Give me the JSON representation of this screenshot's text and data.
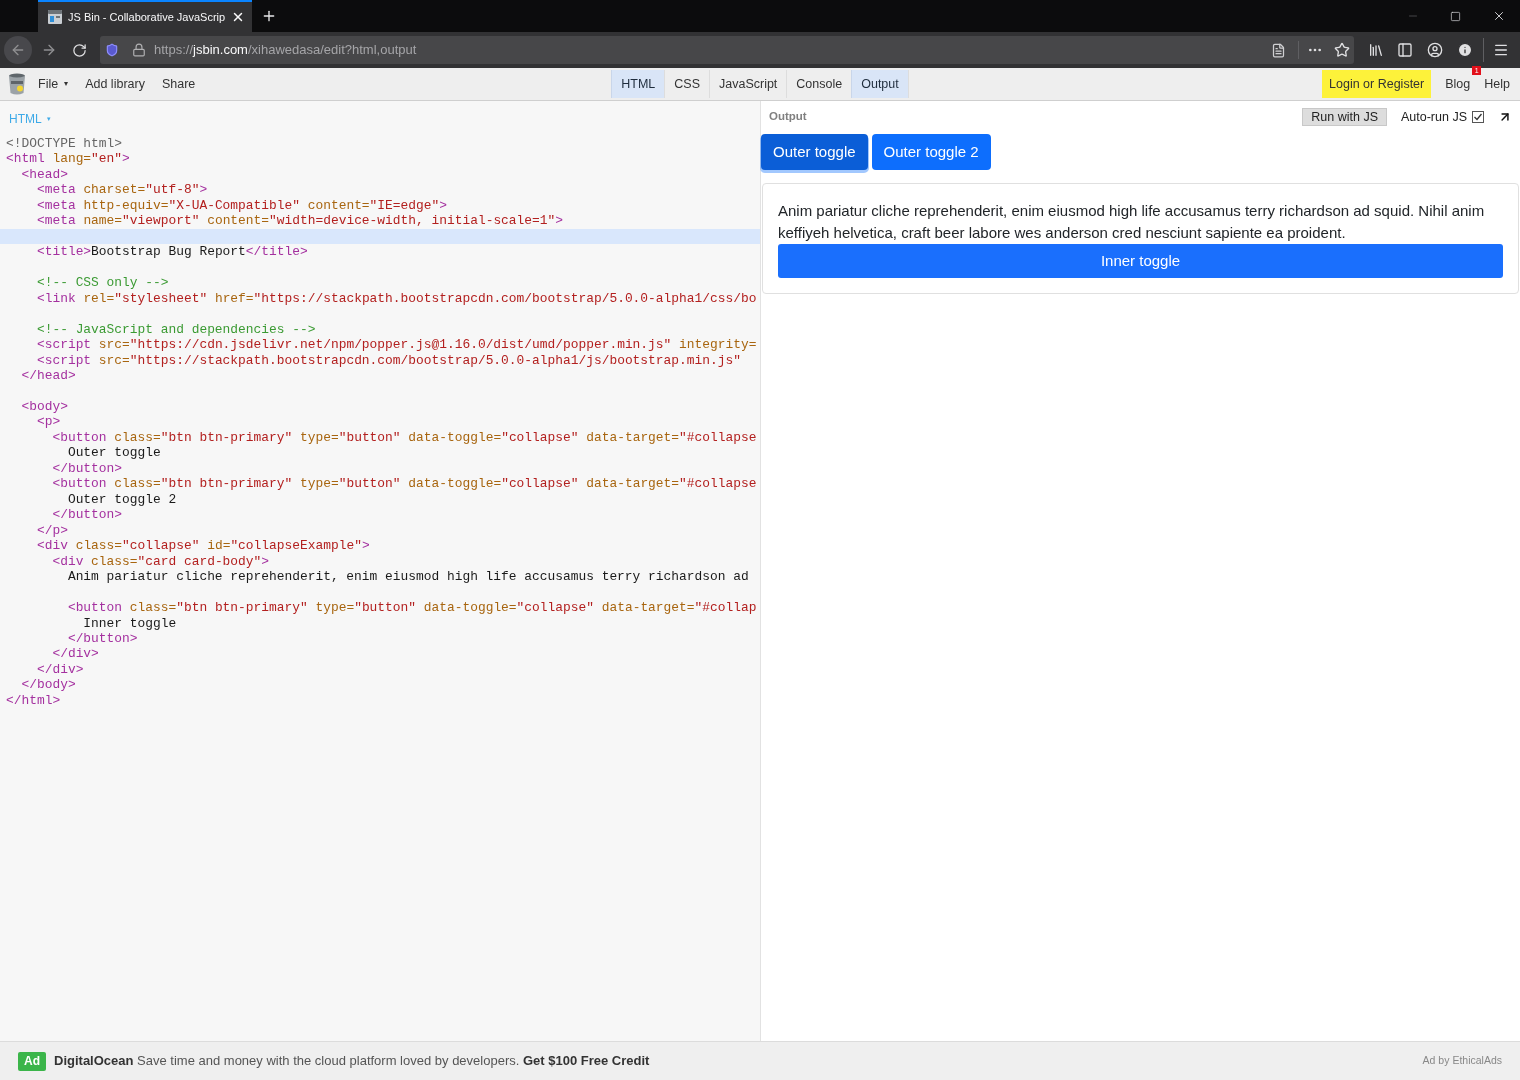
{
  "browser": {
    "tab": {
      "title": "JS Bin - Collaborative JavaScrip",
      "selected": true
    },
    "url": {
      "scheme": "https://",
      "host": "jsbin.com",
      "path": "/xihawedasa/edit?html,output"
    }
  },
  "toolbar": {
    "menu": [
      {
        "label": "File",
        "caret": "▾"
      },
      {
        "label": "Add library"
      },
      {
        "label": "Share"
      }
    ],
    "panels": [
      {
        "label": "HTML",
        "selected": true
      },
      {
        "label": "CSS",
        "selected": false
      },
      {
        "label": "JavaScript",
        "selected": false
      },
      {
        "label": "Console",
        "selected": false
      },
      {
        "label": "Output",
        "selected": true
      }
    ],
    "login": "Login or Register",
    "links": [
      {
        "label": "Blog",
        "badge": "1"
      },
      {
        "label": "Help"
      }
    ]
  },
  "editor": {
    "language": "HTML",
    "caret": "▾",
    "lines": [
      {
        "active": false,
        "tokens": [
          {
            "kind": "meta",
            "text": "<!DOCTYPE html>"
          }
        ]
      },
      {
        "active": false,
        "tokens": [
          {
            "kind": "tag",
            "text": "<html"
          },
          {
            "kind": "attr",
            "text": " lang="
          },
          {
            "kind": "string",
            "text": "\"en\""
          },
          {
            "kind": "tag",
            "text": ">"
          }
        ]
      },
      {
        "active": false,
        "tokens": [
          {
            "kind": "tag",
            "text": "  <head>"
          }
        ]
      },
      {
        "active": false,
        "tokens": [
          {
            "kind": "tag",
            "text": "    <meta"
          },
          {
            "kind": "attr",
            "text": " charset="
          },
          {
            "kind": "string",
            "text": "\"utf-8\""
          },
          {
            "kind": "tag",
            "text": ">"
          }
        ]
      },
      {
        "active": false,
        "tokens": [
          {
            "kind": "tag",
            "text": "    <meta"
          },
          {
            "kind": "attr",
            "text": " http-equiv="
          },
          {
            "kind": "string",
            "text": "\"X-UA-Compatible\""
          },
          {
            "kind": "attr",
            "text": " content="
          },
          {
            "kind": "string",
            "text": "\"IE=edge\""
          },
          {
            "kind": "tag",
            "text": ">"
          }
        ]
      },
      {
        "active": false,
        "tokens": [
          {
            "kind": "tag",
            "text": "    <meta"
          },
          {
            "kind": "attr",
            "text": " name="
          },
          {
            "kind": "string",
            "text": "\"viewport\""
          },
          {
            "kind": "attr",
            "text": " content="
          },
          {
            "kind": "string",
            "text": "\"width=device-width, initial-scale=1\""
          },
          {
            "kind": "tag",
            "text": ">"
          }
        ]
      },
      {
        "active": true
      },
      {
        "active": false,
        "tokens": [
          {
            "kind": "tag",
            "text": "    <title>"
          },
          {
            "kind": "text",
            "text": "Bootstrap Bug Report"
          },
          {
            "kind": "tag",
            "text": "</title>"
          }
        ]
      },
      {
        "active": false
      },
      {
        "active": false,
        "tokens": [
          {
            "kind": "comment",
            "text": "    <!-- CSS only -->"
          }
        ]
      },
      {
        "active": false,
        "tokens": [
          {
            "kind": "tag",
            "text": "    <link"
          },
          {
            "kind": "attr",
            "text": " rel="
          },
          {
            "kind": "string",
            "text": "\"stylesheet\""
          },
          {
            "kind": "attr",
            "text": " href="
          },
          {
            "kind": "string",
            "text": "\"https://stackpath.bootstrapcdn.com/bootstrap/5.0.0-alpha1/css/bo"
          }
        ]
      },
      {
        "active": false
      },
      {
        "active": false,
        "tokens": [
          {
            "kind": "comment",
            "text": "    <!-- JavaScript and dependencies -->"
          }
        ]
      },
      {
        "active": false,
        "tokens": [
          {
            "kind": "tag",
            "text": "    <script"
          },
          {
            "kind": "attr",
            "text": " src="
          },
          {
            "kind": "string",
            "text": "\"https://cdn.jsdelivr.net/npm/popper.js@1.16.0/dist/umd/popper.min.js\""
          },
          {
            "kind": "attr",
            "text": " integrity="
          }
        ]
      },
      {
        "active": false,
        "tokens": [
          {
            "kind": "tag",
            "text": "    <script"
          },
          {
            "kind": "attr",
            "text": " src="
          },
          {
            "kind": "string",
            "text": "\"https://stackpath.bootstrapcdn.com/bootstrap/5.0.0-alpha1/js/bootstrap.min.js\""
          }
        ]
      },
      {
        "active": false,
        "tokens": [
          {
            "kind": "tag",
            "text": "  </head>"
          }
        ]
      },
      {
        "active": false
      },
      {
        "active": false,
        "tokens": [
          {
            "kind": "tag",
            "text": "  <body>"
          }
        ]
      },
      {
        "active": false,
        "tokens": [
          {
            "kind": "tag",
            "text": "    <p>"
          }
        ]
      },
      {
        "active": false,
        "tokens": [
          {
            "kind": "tag",
            "text": "      <button"
          },
          {
            "kind": "attr",
            "text": " class="
          },
          {
            "kind": "string",
            "text": "\"btn btn-primary\""
          },
          {
            "kind": "attr",
            "text": " type="
          },
          {
            "kind": "string",
            "text": "\"button\""
          },
          {
            "kind": "attr",
            "text": " data-toggle="
          },
          {
            "kind": "string",
            "text": "\"collapse\""
          },
          {
            "kind": "attr",
            "text": " data-target="
          },
          {
            "kind": "string",
            "text": "\"#collapse"
          }
        ]
      },
      {
        "active": false,
        "tokens": [
          {
            "kind": "text",
            "text": "        Outer toggle"
          }
        ]
      },
      {
        "active": false,
        "tokens": [
          {
            "kind": "tag",
            "text": "      </button>"
          }
        ]
      },
      {
        "active": false,
        "tokens": [
          {
            "kind": "tag",
            "text": "      <button"
          },
          {
            "kind": "attr",
            "text": " class="
          },
          {
            "kind": "string",
            "text": "\"btn btn-primary\""
          },
          {
            "kind": "attr",
            "text": " type="
          },
          {
            "kind": "string",
            "text": "\"button\""
          },
          {
            "kind": "attr",
            "text": " data-toggle="
          },
          {
            "kind": "string",
            "text": "\"collapse\""
          },
          {
            "kind": "attr",
            "text": " data-target="
          },
          {
            "kind": "string",
            "text": "\"#collapse"
          }
        ]
      },
      {
        "active": false,
        "tokens": [
          {
            "kind": "text",
            "text": "        Outer toggle 2"
          }
        ]
      },
      {
        "active": false,
        "tokens": [
          {
            "kind": "tag",
            "text": "      </button>"
          }
        ]
      },
      {
        "active": false,
        "tokens": [
          {
            "kind": "tag",
            "text": "    </p>"
          }
        ]
      },
      {
        "active": false,
        "tokens": [
          {
            "kind": "tag",
            "text": "    <div"
          },
          {
            "kind": "attr",
            "text": " class="
          },
          {
            "kind": "string",
            "text": "\"collapse\""
          },
          {
            "kind": "attr",
            "text": " id="
          },
          {
            "kind": "string",
            "text": "\"collapseExample\""
          },
          {
            "kind": "tag",
            "text": ">"
          }
        ]
      },
      {
        "active": false,
        "tokens": [
          {
            "kind": "tag",
            "text": "      <div"
          },
          {
            "kind": "attr",
            "text": " class="
          },
          {
            "kind": "string",
            "text": "\"card card-body\""
          },
          {
            "kind": "tag",
            "text": ">"
          }
        ]
      },
      {
        "active": false,
        "tokens": [
          {
            "kind": "text",
            "text": "        Anim pariatur cliche reprehenderit, enim eiusmod high life accusamus terry richardson ad"
          }
        ]
      },
      {
        "active": false
      },
      {
        "active": false,
        "tokens": [
          {
            "kind": "tag",
            "text": "        <button"
          },
          {
            "kind": "attr",
            "text": " class="
          },
          {
            "kind": "string",
            "text": "\"btn btn-primary\""
          },
          {
            "kind": "attr",
            "text": " type="
          },
          {
            "kind": "string",
            "text": "\"button\""
          },
          {
            "kind": "attr",
            "text": " data-toggle="
          },
          {
            "kind": "string",
            "text": "\"collapse\""
          },
          {
            "kind": "attr",
            "text": " data-target="
          },
          {
            "kind": "string",
            "text": "\"#collap"
          }
        ]
      },
      {
        "active": false,
        "tokens": [
          {
            "kind": "text",
            "text": "          Inner toggle"
          }
        ]
      },
      {
        "active": false,
        "tokens": [
          {
            "kind": "tag",
            "text": "        </button>"
          }
        ]
      },
      {
        "active": false,
        "tokens": [
          {
            "kind": "tag",
            "text": "      </div>"
          }
        ]
      },
      {
        "active": false,
        "tokens": [
          {
            "kind": "tag",
            "text": "    </div>"
          }
        ]
      },
      {
        "active": false,
        "tokens": [
          {
            "kind": "tag",
            "text": "  </body>"
          }
        ]
      },
      {
        "active": false,
        "tokens": [
          {
            "kind": "tag",
            "text": "</html>"
          }
        ]
      }
    ]
  },
  "output": {
    "label": "Output",
    "run_button": "Run with JS",
    "autorun": {
      "label": "Auto-run JS",
      "checked": true
    },
    "buttons": [
      {
        "label": "Outer toggle",
        "focused": true
      },
      {
        "label": "Outer toggle 2",
        "focused": false
      }
    ],
    "card": {
      "text": "Anim pariatur cliche reprehenderit, enim eiusmod high life accusamus terry richardson ad squid. Nihil anim keffiyeh helvetica, craft beer labore wes anderson cred nesciunt sapiente ea proident.",
      "button": "Inner toggle"
    }
  },
  "ad": {
    "badge": "Ad",
    "text": "**DigitalOcean** Save time and money with the cloud platform loved by developers. **Get $100 Free Credit**",
    "credit": "Ad by EthicalAds"
  }
}
